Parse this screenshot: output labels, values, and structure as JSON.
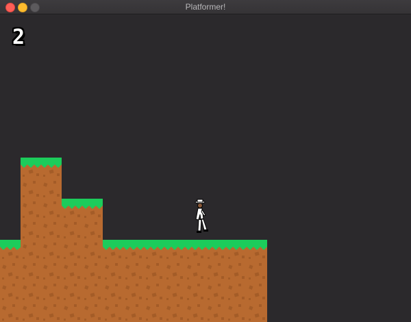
{
  "window": {
    "title": "Platformer!"
  },
  "hud": {
    "score": "2"
  },
  "colors": {
    "background": "#2b292c",
    "grass": "#1ccc5b",
    "grass_dark": "#11a84a",
    "dirt": "#b86a30",
    "dirt_speckle": "#a45c27"
  },
  "icons": {
    "close": "close-icon",
    "minimize": "minimize-icon",
    "maximize": "maximize-icon",
    "player": "player-sprite"
  }
}
